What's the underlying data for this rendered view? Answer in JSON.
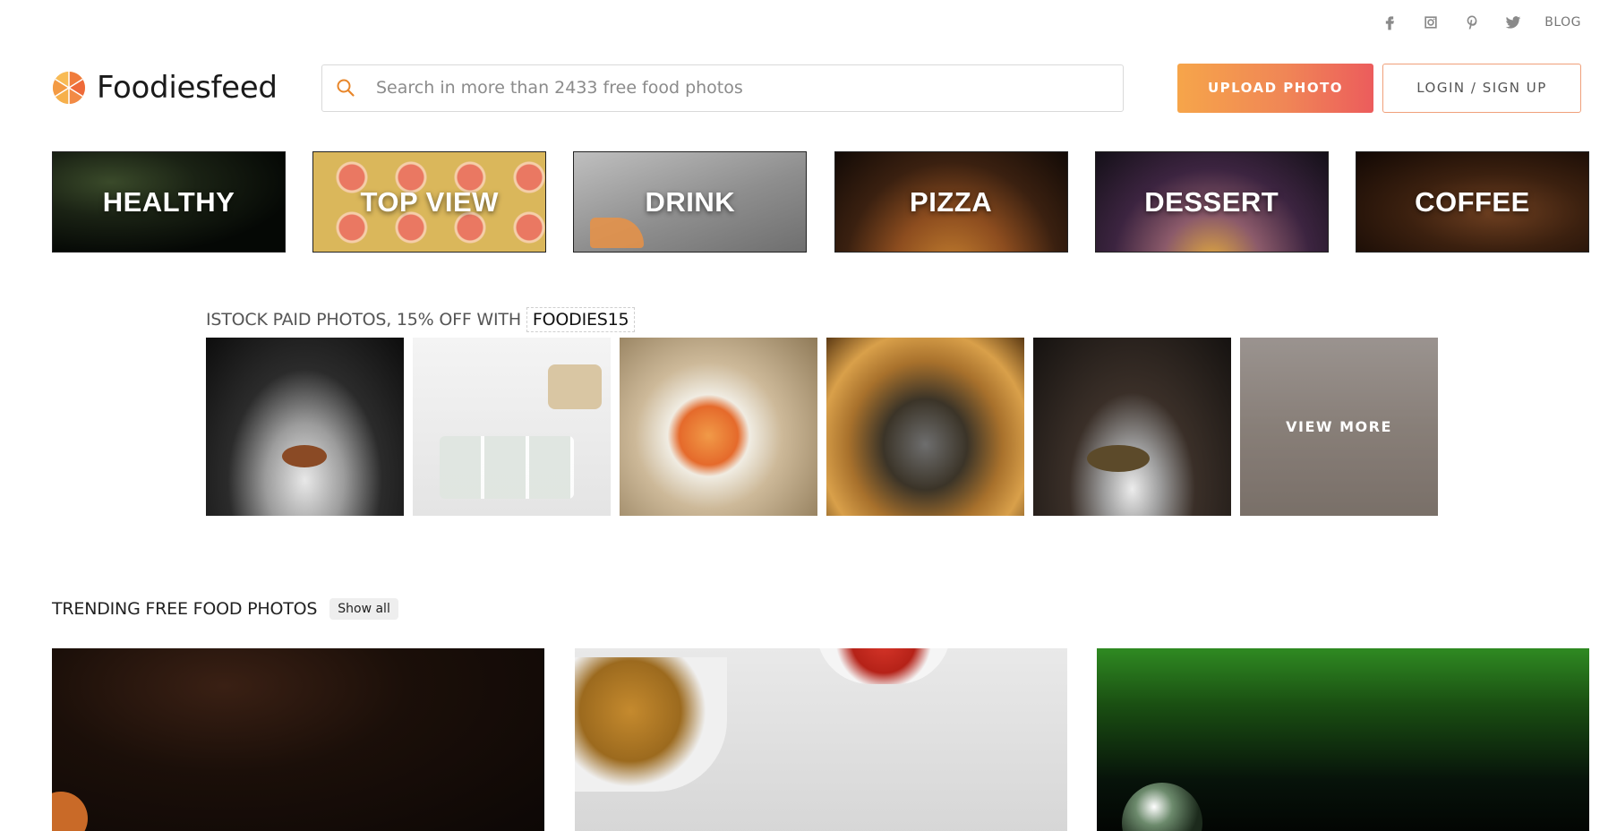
{
  "social": {
    "icons": [
      "facebook-icon",
      "instagram-icon",
      "pinterest-icon",
      "twitter-icon"
    ],
    "blog_label": "BLOG"
  },
  "header": {
    "logo_text": "Foodiesfeed",
    "search_placeholder": "Search in more than 2433 free food photos",
    "upload_label": "UPLOAD PHOTO",
    "login_label": "LOGIN / SIGN UP"
  },
  "categories": [
    {
      "label": "HEALTHY"
    },
    {
      "label": "TOP VIEW"
    },
    {
      "label": "DRINK"
    },
    {
      "label": "PIZZA"
    },
    {
      "label": "DESSERT"
    },
    {
      "label": "COFFEE"
    }
  ],
  "istock": {
    "title": "ISTOCK PAID PHOTOS, 15% OFF WITH",
    "code": "FOODIES15",
    "view_more": "VIEW MORE"
  },
  "trending": {
    "title": "TRENDING FREE FOOD PHOTOS",
    "show_all": "Show all"
  },
  "colors": {
    "accent_orange": "#f6a54a",
    "accent_red": "#ec5c5c",
    "login_border": "#f0a07a",
    "search_icon": "#e8862a"
  }
}
